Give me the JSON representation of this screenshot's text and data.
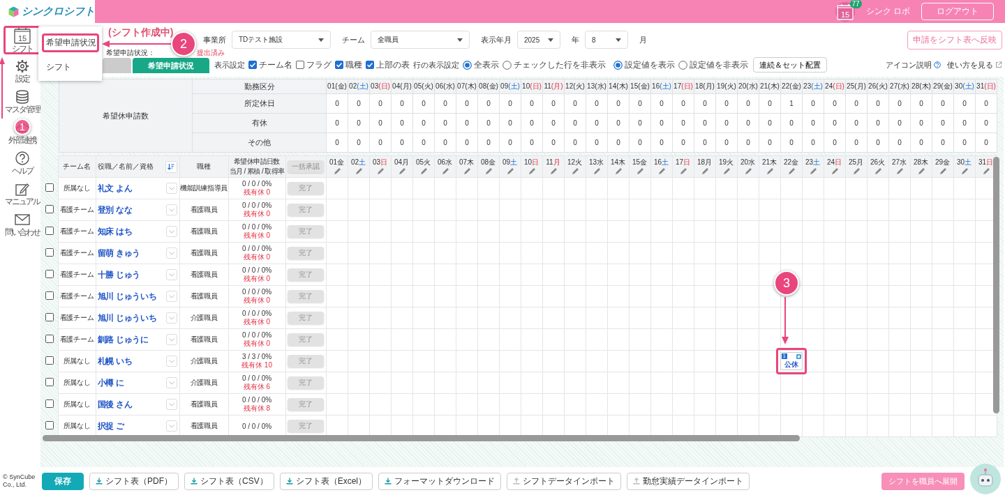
{
  "header": {
    "logo_text": "シンクロシフト",
    "calendar_day": "15",
    "badge": "77",
    "user": "シンク ロボ",
    "logout": "ログアウト"
  },
  "sidebar": {
    "items": [
      {
        "label": "シフト",
        "icon_text": "15",
        "highlighted": true
      },
      {
        "label": "設定",
        "highlighted": false
      },
      {
        "label": "マスタ管理",
        "highlighted": false
      },
      {
        "label": "外部連携",
        "highlighted": false
      },
      {
        "label": "ヘルプ",
        "highlighted": false
      },
      {
        "label": "マニュアル",
        "highlighted": false
      },
      {
        "label": "問い合わせ",
        "highlighted": false
      }
    ]
  },
  "menu": {
    "items": [
      {
        "label": "希望申請状況",
        "highlighted": true
      },
      {
        "label": "シフト",
        "highlighted": false
      }
    ]
  },
  "title": "(シフト作成中)",
  "status": {
    "label": "希望申請状況：",
    "value": "提出済み"
  },
  "filters": [
    {
      "label": "事業所",
      "value": "TDテスト施設",
      "kind": "wide"
    },
    {
      "label": "チーム",
      "value": "全職員",
      "kind": "wide"
    },
    {
      "label": "表示年月",
      "value": "2025",
      "suffix": "年",
      "kind": "narrow"
    },
    {
      "value": "8",
      "suffix": "月",
      "kind": "narrow"
    }
  ],
  "reflect_button": "申請をシフト表へ反映",
  "tabs": [
    {
      "selected": false
    },
    {
      "label": "希望申請状況",
      "selected": true
    }
  ],
  "display_settings": {
    "label": "表示設定",
    "checkboxes": [
      {
        "label": "チーム名",
        "checked": true
      },
      {
        "label": "フラグ",
        "checked": false
      },
      {
        "label": "職種",
        "checked": true
      },
      {
        "label": "上部の表",
        "checked": true
      }
    ]
  },
  "row_display": {
    "label": "行の表示設定",
    "radios": [
      {
        "label": "全表示",
        "selected": true
      },
      {
        "label": "チェックした行を非表示",
        "selected": false
      }
    ]
  },
  "value_display": {
    "radios": [
      {
        "label": "設定値を表示",
        "selected": true
      },
      {
        "label": "設定値を非表示",
        "selected": false
      }
    ]
  },
  "set_button": "連続＆セット配置",
  "help_links": [
    {
      "label": "アイコン説明",
      "kind": "help"
    },
    {
      "label": "使い方を見る",
      "kind": "external"
    }
  ],
  "summary_table": {
    "row_group": "希望休申請数",
    "kubun_header": "勤務区分",
    "days": [
      {
        "date": "01",
        "weekday": "(金)",
        "kind": "weekday"
      },
      {
        "date": "02",
        "weekday": "(土)",
        "kind": "saturday"
      },
      {
        "date": "03",
        "weekday": "(日)",
        "kind": "sunday"
      },
      {
        "date": "04",
        "weekday": "(月)",
        "kind": "weekday"
      },
      {
        "date": "05",
        "weekday": "(火)",
        "kind": "weekday"
      },
      {
        "date": "06",
        "weekday": "(水)",
        "kind": "weekday"
      },
      {
        "date": "07",
        "weekday": "(木)",
        "kind": "weekday"
      },
      {
        "date": "08",
        "weekday": "(金)",
        "kind": "weekday"
      },
      {
        "date": "09",
        "weekday": "(土)",
        "kind": "saturday"
      },
      {
        "date": "10",
        "weekday": "(日)",
        "kind": "sunday"
      },
      {
        "date": "11",
        "weekday": "(月)",
        "kind": "holiday"
      },
      {
        "date": "12",
        "weekday": "(火)",
        "kind": "weekday"
      },
      {
        "date": "13",
        "weekday": "(水)",
        "kind": "weekday"
      },
      {
        "date": "14",
        "weekday": "(木)",
        "kind": "weekday"
      },
      {
        "date": "15",
        "weekday": "(金)",
        "kind": "weekday"
      },
      {
        "date": "16",
        "weekday": "(土)",
        "kind": "saturday"
      },
      {
        "date": "17",
        "weekday": "(日)",
        "kind": "sunday"
      },
      {
        "date": "18",
        "weekday": "(月)",
        "kind": "weekday"
      },
      {
        "date": "19",
        "weekday": "(火)",
        "kind": "weekday"
      },
      {
        "date": "20",
        "weekday": "(水)",
        "kind": "weekday"
      },
      {
        "date": "21",
        "weekday": "(木)",
        "kind": "weekday"
      },
      {
        "date": "22",
        "weekday": "(金)",
        "kind": "weekday"
      },
      {
        "date": "23",
        "weekday": "(土)",
        "kind": "saturday"
      },
      {
        "date": "24",
        "weekday": "(日)",
        "kind": "sunday"
      },
      {
        "date": "25",
        "weekday": "(月)",
        "kind": "weekday"
      },
      {
        "date": "26",
        "weekday": "(火)",
        "kind": "weekday"
      },
      {
        "date": "27",
        "weekday": "(水)",
        "kind": "weekday"
      },
      {
        "date": "28",
        "weekday": "(木)",
        "kind": "weekday"
      },
      {
        "date": "29",
        "weekday": "(金)",
        "kind": "weekday"
      },
      {
        "date": "30",
        "weekday": "(土)",
        "kind": "saturday"
      },
      {
        "date": "31",
        "weekday": "(日)",
        "kind": "sunday"
      }
    ],
    "rows": [
      {
        "label": "所定休日",
        "values": [
          "0",
          "0",
          "0",
          "0",
          "0",
          "0",
          "0",
          "0",
          "0",
          "0",
          "0",
          "0",
          "0",
          "0",
          "0",
          "0",
          "0",
          "0",
          "0",
          "0",
          "0",
          "1",
          "0",
          "0",
          "0",
          "0",
          "0",
          "0",
          "0",
          "0",
          "0"
        ]
      },
      {
        "label": "有休",
        "values": [
          "0",
          "0",
          "0",
          "0",
          "0",
          "0",
          "0",
          "0",
          "0",
          "0",
          "0",
          "0",
          "0",
          "0",
          "0",
          "0",
          "0",
          "0",
          "0",
          "0",
          "0",
          "0",
          "0",
          "0",
          "0",
          "0",
          "0",
          "0",
          "0",
          "0",
          "0"
        ]
      },
      {
        "label": "その他",
        "values": [
          "0",
          "0",
          "0",
          "0",
          "0",
          "0",
          "0",
          "0",
          "0",
          "0",
          "0",
          "0",
          "0",
          "0",
          "0",
          "0",
          "0",
          "0",
          "0",
          "0",
          "0",
          "0",
          "0",
          "0",
          "0",
          "0",
          "0",
          "0",
          "0",
          "0",
          "0"
        ]
      }
    ]
  },
  "staff_table": {
    "headers": {
      "team": "チーム名",
      "name": "役職／名前／資格",
      "job": "職種",
      "days_count": "希望休申請日数",
      "days_count_sub": "当月 / 累積 / 取得率",
      "bulk_button": "一括承認",
      "bulk_disabled": true
    },
    "days": [
      {
        "date": "01",
        "weekday": "金",
        "kind": "weekday"
      },
      {
        "date": "02",
        "weekday": "土",
        "kind": "saturday"
      },
      {
        "date": "03",
        "weekday": "日",
        "kind": "sunday"
      },
      {
        "date": "04",
        "weekday": "月",
        "kind": "weekday"
      },
      {
        "date": "05",
        "weekday": "火",
        "kind": "weekday"
      },
      {
        "date": "06",
        "weekday": "水",
        "kind": "weekday"
      },
      {
        "date": "07",
        "weekday": "木",
        "kind": "weekday"
      },
      {
        "date": "08",
        "weekday": "金",
        "kind": "weekday"
      },
      {
        "date": "09",
        "weekday": "土",
        "kind": "saturday"
      },
      {
        "date": "10",
        "weekday": "日",
        "kind": "sunday"
      },
      {
        "date": "11",
        "weekday": "月",
        "kind": "holiday"
      },
      {
        "date": "12",
        "weekday": "火",
        "kind": "weekday"
      },
      {
        "date": "13",
        "weekday": "水",
        "kind": "weekday"
      },
      {
        "date": "14",
        "weekday": "木",
        "kind": "weekday"
      },
      {
        "date": "15",
        "weekday": "金",
        "kind": "weekday"
      },
      {
        "date": "16",
        "weekday": "土",
        "kind": "saturday"
      },
      {
        "date": "17",
        "weekday": "日",
        "kind": "sunday"
      },
      {
        "date": "18",
        "weekday": "月",
        "kind": "weekday"
      },
      {
        "date": "19",
        "weekday": "火",
        "kind": "weekday"
      },
      {
        "date": "20",
        "weekday": "水",
        "kind": "weekday"
      },
      {
        "date": "21",
        "weekday": "木",
        "kind": "weekday"
      },
      {
        "date": "22",
        "weekday": "金",
        "kind": "weekday"
      },
      {
        "date": "23",
        "weekday": "土",
        "kind": "saturday"
      },
      {
        "date": "24",
        "weekday": "日",
        "kind": "sunday"
      },
      {
        "date": "25",
        "weekday": "月",
        "kind": "weekday"
      },
      {
        "date": "26",
        "weekday": "火",
        "kind": "weekday"
      },
      {
        "date": "27",
        "weekday": "水",
        "kind": "weekday"
      },
      {
        "date": "28",
        "weekday": "木",
        "kind": "weekday"
      },
      {
        "date": "29",
        "weekday": "金",
        "kind": "weekday"
      },
      {
        "date": "30",
        "weekday": "土",
        "kind": "saturday"
      },
      {
        "date": "31",
        "weekday": "日",
        "kind": "sunday"
      }
    ],
    "rows": [
      {
        "checked": false,
        "team": "所属なし",
        "name": "礼文 よん",
        "job": "機能訓練指導員",
        "counts": "0 / 0 / 0%",
        "remaining": "残有休 0",
        "action": "完了",
        "action_disabled": true
      },
      {
        "checked": false,
        "team": "看護チーム",
        "name": "登別 なな",
        "job": "看護職員",
        "counts": "0 / 0 / 0%",
        "remaining": "残有休 0",
        "action": "完了",
        "action_disabled": true
      },
      {
        "checked": false,
        "team": "看護チーム",
        "name": "知床 はち",
        "job": "看護職員",
        "counts": "0 / 0 / 0%",
        "remaining": "残有休 0",
        "action": "完了",
        "action_disabled": true
      },
      {
        "checked": false,
        "team": "看護チーム",
        "name": "留萌 きゅう",
        "job": "看護職員",
        "counts": "0 / 0 / 0%",
        "remaining": "残有休 0",
        "action": "完了",
        "action_disabled": true
      },
      {
        "checked": false,
        "team": "看護チーム",
        "name": "十勝 じゅう",
        "job": "看護職員",
        "counts": "0 / 0 / 0%",
        "remaining": "残有休 0",
        "action": "完了",
        "action_disabled": true
      },
      {
        "checked": false,
        "team": "看護チーム",
        "name": "旭川 じゅういち",
        "job": "看護職員",
        "counts": "0 / 0 / 0%",
        "remaining": "残有休 0",
        "action": "完了",
        "action_disabled": true
      },
      {
        "checked": false,
        "team": "看護チーム",
        "name": "旭川 じゅういち",
        "job": "介護職員",
        "counts": "0 / 0 / 0%",
        "remaining": "残有休 0",
        "action": "完了",
        "action_disabled": true
      },
      {
        "checked": false,
        "team": "看護チーム",
        "name": "釧路 じゅうに",
        "job": "看護職員",
        "counts": "0 / 0 / 0%",
        "remaining": "残有休 0",
        "action": "完了",
        "action_disabled": true
      },
      {
        "checked": false,
        "team": "所属なし",
        "name": "札幌 いち",
        "job": "介護職員",
        "counts": "3 / 3 / 0%",
        "remaining": "残有休 10",
        "action": "完了",
        "action_disabled": true,
        "cells": [
          null,
          null,
          null,
          null,
          null,
          null,
          null,
          null,
          null,
          null,
          null,
          null,
          null,
          null,
          null,
          null,
          null,
          null,
          null,
          null,
          null,
          {
            "label": "公休",
            "badge": "1",
            "highlighted": true
          },
          null,
          null,
          null,
          null,
          null,
          null,
          null,
          null,
          null
        ]
      },
      {
        "checked": false,
        "team": "所属なし",
        "name": "小樽 に",
        "job": "介護職員",
        "counts": "0 / 0 / 0%",
        "remaining": "残有休 6",
        "action": "完了",
        "action_disabled": true
      },
      {
        "checked": false,
        "team": "所属なし",
        "name": "国後 さん",
        "job": "看護職員",
        "counts": "0 / 0 / 0%",
        "remaining": "残有休 8",
        "action": "完了",
        "action_disabled": true
      },
      {
        "checked": false,
        "team": "所属なし",
        "name": "択捉 ご",
        "job": "看護職員",
        "counts": "0 / 0 / 0%",
        "action": "完了",
        "action_disabled": true
      }
    ]
  },
  "footer": {
    "copyright": "© SynCube Co., Ltd.",
    "buttons": [
      {
        "label": "保存",
        "kind": "primary"
      },
      {
        "label": "シフト表（PDF）",
        "kind": "download"
      },
      {
        "label": "シフト表（CSV）",
        "kind": "download"
      },
      {
        "label": "シフト表（Excel）",
        "kind": "download"
      },
      {
        "label": "フォーマットダウンロード",
        "kind": "download"
      },
      {
        "label": "シフトデータインポート",
        "kind": "upload"
      },
      {
        "label": "勤怠実績データインポート",
        "kind": "upload"
      }
    ],
    "deploy_button": "シフトを職員へ展開"
  },
  "annotations": [
    {
      "number": "1"
    },
    {
      "number": "2"
    },
    {
      "number": "3"
    }
  ]
}
